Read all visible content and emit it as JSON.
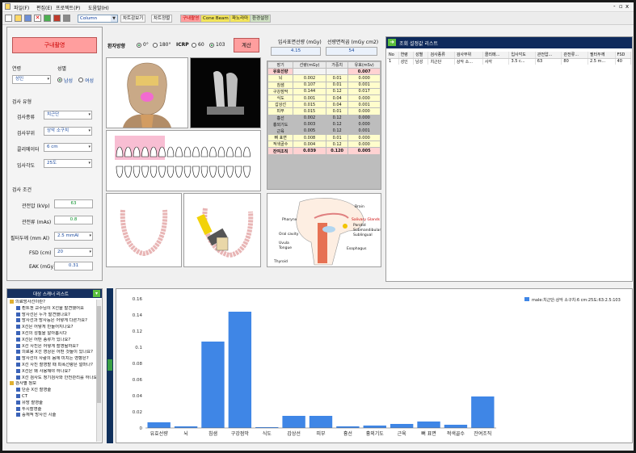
{
  "menu": [
    "파일(F)",
    "편집(E)",
    "프로젝트(P)",
    "도움말(H)"
  ],
  "window_controls": [
    "-",
    "▫",
    "x"
  ],
  "toolbar": {
    "chart_type": "Column",
    "buttons": [
      "차트감보기",
      "차트정렬",
      "구내촬영",
      "Cone Beam CT",
      "파노라마",
      "환경설정"
    ]
  },
  "exam": {
    "title": "구내촬영",
    "age_label": "연령",
    "age_value": "성인",
    "sex_label": "성별",
    "sex_options": [
      "남성",
      "여성"
    ],
    "sex_selected": "남성",
    "section_exam": "검사 유형",
    "type_label": "검사종류",
    "type_value": "치근단",
    "site_label": "검사부위",
    "site_value": "상악 소구치",
    "collimator_label": "콜리메이터",
    "collimator_value": "6 cm",
    "angle_label": "입사각도",
    "angle_value": "25도",
    "section_cond": "검사 조건",
    "kvp_label": "관전압 (kVp)",
    "kvp_value": "63",
    "mas_label": "관전류 (mAs)",
    "mas_value": "0.8",
    "filter_label": "필터두께 (mm Al)",
    "filter_value": "2.5 mmAl",
    "fsd_label": "FSD (cm)",
    "fsd_value": "20",
    "eak_label": "EAK (mGy)",
    "eak_value": "0.31"
  },
  "orientation": {
    "label": "환자방향",
    "options": [
      "0°",
      "180°"
    ],
    "selected": "0°",
    "icrp_label": "ICRP",
    "icrp_options": [
      "60",
      "103"
    ],
    "icrp_selected": "103",
    "calc_button": "계산"
  },
  "summary": {
    "entrance_label": "입사표면선량 (mGy)",
    "entrance_value": "4.15",
    "dap_label": "선량면적곱 (mGy cm2)",
    "dap_value": "54"
  },
  "dose_table": {
    "headers": [
      "장기",
      "선량(mGy)",
      "가중치",
      "유효(mSv)"
    ],
    "rows": [
      {
        "organ": "유효선량",
        "dose": "",
        "weight": "",
        "eff": "0.007",
        "kind": "head"
      },
      {
        "organ": "뇌",
        "dose": "0.002",
        "weight": "0.01",
        "eff": "0.000",
        "kind": "yel"
      },
      {
        "organ": "침샘",
        "dose": "0.107",
        "weight": "0.01",
        "eff": "0.001",
        "kind": "yel"
      },
      {
        "organ": "구강점막",
        "dose": "0.144",
        "weight": "0.12",
        "eff": "0.017",
        "kind": "yel"
      },
      {
        "organ": "식도",
        "dose": "0.001",
        "weight": "0.04",
        "eff": "0.000",
        "kind": "yel"
      },
      {
        "organ": "갑상선",
        "dose": "0.015",
        "weight": "0.04",
        "eff": "0.001",
        "kind": "yel"
      },
      {
        "organ": "피부",
        "dose": "0.015",
        "weight": "0.01",
        "eff": "0.000",
        "kind": "yel"
      },
      {
        "organ": "흉선",
        "dose": "0.002",
        "weight": "0.12",
        "eff": "0.000",
        "kind": "plain"
      },
      {
        "organ": "흉외기도",
        "dose": "0.003",
        "weight": "0.12",
        "eff": "0.000",
        "kind": "plain"
      },
      {
        "organ": "근육",
        "dose": "0.005",
        "weight": "0.12",
        "eff": "0.001",
        "kind": "plain"
      },
      {
        "organ": "뼈 표면",
        "dose": "0.008",
        "weight": "0.01",
        "eff": "0.000",
        "kind": "yel"
      },
      {
        "organ": "적색골수",
        "dose": "0.004",
        "weight": "0.12",
        "eff": "0.000",
        "kind": "yel"
      },
      {
        "organ": "잔여조직",
        "dose": "0.039",
        "weight": "0.120",
        "eff": "0.005",
        "kind": "sum"
      }
    ]
  },
  "history": {
    "title": "조회 설정값 리스트",
    "headers": [
      "No",
      "연령",
      "성별",
      "검사종류",
      "검사부위",
      "콜리메...",
      "입사각도",
      "관전압...",
      "관전류...",
      "필터두께",
      "FSD"
    ],
    "rows": [
      [
        "1",
        "성인",
        "남성",
        "치근단",
        "상악 소...",
        "사각",
        "3.5 c...",
        "63",
        "80",
        "2.5 m...",
        "40"
      ]
    ]
  },
  "questions": {
    "title": "대상 스캐너 리스트",
    "items": [
      {
        "text": "의료방사선이란?",
        "folder": true
      },
      {
        "text": "뢴트겐 교수님이 X선을 발견했어요",
        "folder": false
      },
      {
        "text": "방사선은 누가 발견했나요?",
        "folder": false
      },
      {
        "text": "방사선과 방사능은 어떻게 다른가요?",
        "folder": false
      },
      {
        "text": "X선은 어떻게 만들어지나요?",
        "folder": false
      },
      {
        "text": "X선의 성질을 알아봅시다",
        "folder": false
      },
      {
        "text": "X선은 어떤 종류가 있나요?",
        "folder": false
      },
      {
        "text": "X선 사진은 어떻게 촬영될까요?",
        "folder": false
      },
      {
        "text": "의료용 X선 영상은 어떤 것들이 있나요?",
        "folder": false
      },
      {
        "text": "방사선이 사람의 몸에 미치는 영향은?",
        "folder": false
      },
      {
        "text": "X선 사진 촬영할 때 피폭선량은 얼마나?",
        "folder": false
      },
      {
        "text": "X선은 왜 사용해야 하나요?",
        "folder": false
      },
      {
        "text": "X선 검사도 정기검사와 안전관리를 하나요?",
        "folder": false
      },
      {
        "text": "검사별 정보",
        "folder": true
      },
      {
        "text": "단순 X선 촬영술",
        "folder": false
      },
      {
        "text": "CT",
        "folder": false
      },
      {
        "text": "유방 촬영술",
        "folder": false
      },
      {
        "text": "투시촬영술",
        "folder": false
      },
      {
        "text": "중재적 방사선 시술",
        "folder": false
      }
    ]
  },
  "anatomy_labels": [
    "Brain",
    "Pharynx",
    "Salivary Glands",
    "Parotid",
    "Submandibular",
    "Sublingual",
    "Oral cavity",
    "Uvula",
    "Tongue",
    "Thyroid",
    "Esophagus"
  ],
  "colors": {
    "bar": "#3f86e6",
    "calc_button": "#ff9e9e",
    "tab_active": "#ff9e9e",
    "cbct_tab": "#f3e55a"
  },
  "chart_data": {
    "type": "bar",
    "categories": [
      "유효선량",
      "뇌",
      "침샘",
      "구강점막",
      "식도",
      "갑상선",
      "피부",
      "흉선",
      "흉외기도",
      "근육",
      "뼈 표면",
      "적색골수",
      "잔여조직"
    ],
    "series": [
      {
        "name": "male:치근단:상악 소구치:6 cm:25도:63:2.5:103",
        "values": [
          0.007,
          0.002,
          0.107,
          0.144,
          0.001,
          0.015,
          0.015,
          0.002,
          0.003,
          0.005,
          0.008,
          0.004,
          0.039
        ]
      }
    ],
    "yticks": [
      "0",
      "0.02",
      "0.04",
      "0.06",
      "0.08",
      "0.1",
      "0.12",
      "0.14",
      "0.16"
    ],
    "ylim": [
      0,
      0.16
    ],
    "grid": false,
    "legend": "top-right"
  }
}
